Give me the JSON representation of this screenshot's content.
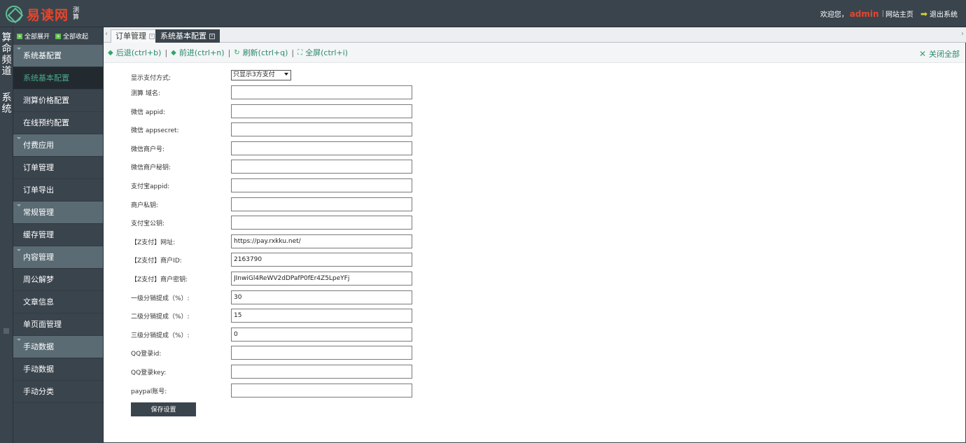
{
  "topbar": {
    "logo_text": "易读网",
    "logo_sub": "测算",
    "welcome": "欢迎您，",
    "user": "admin",
    "site_home": "网站主页",
    "logout": "退出系统",
    "separator": "|"
  },
  "channel": {
    "items": [
      "算命频道",
      "系统"
    ]
  },
  "sidebar": {
    "expand_all": "全部展开",
    "collapse_all": "全部收起",
    "menu": [
      {
        "type": "group",
        "label": "系统基配置"
      },
      {
        "type": "item",
        "label": "系统基本配置",
        "active": true
      },
      {
        "type": "item",
        "label": "测算价格配置"
      },
      {
        "type": "item",
        "label": "在线预约配置"
      },
      {
        "type": "group",
        "label": "付费应用"
      },
      {
        "type": "item",
        "label": "订单管理"
      },
      {
        "type": "item",
        "label": "订单导出"
      },
      {
        "type": "group",
        "label": "常规管理"
      },
      {
        "type": "item",
        "label": "缓存管理"
      },
      {
        "type": "group",
        "label": "内容管理"
      },
      {
        "type": "item",
        "label": "周公解梦"
      },
      {
        "type": "item",
        "label": "文章信息"
      },
      {
        "type": "item",
        "label": "单页面管理"
      },
      {
        "type": "group",
        "label": "手动数据"
      },
      {
        "type": "item",
        "label": "手动数据"
      },
      {
        "type": "item",
        "label": "手动分类"
      }
    ]
  },
  "tabs": {
    "items": [
      {
        "label": "订单管理",
        "active": false
      },
      {
        "label": "系统基本配置",
        "active": true
      }
    ]
  },
  "toolbar": {
    "back": "后退(ctrl+b)",
    "forward": "前进(ctrl+n)",
    "refresh": "刷新(ctrl+q)",
    "fullscreen": "全屏(ctrl+i)",
    "sep": "|",
    "close_all": "关闭全部"
  },
  "form": {
    "pay_mode_label": "显示支付方式:",
    "pay_mode_value": "只显示3方支付",
    "fields": [
      {
        "label": "测算 域名:",
        "value": "",
        "name": "domain-field"
      },
      {
        "label": "微信 appid:",
        "value": "",
        "name": "wechat-appid-field"
      },
      {
        "label": "微信 appsecret:",
        "value": "",
        "name": "wechat-appsecret-field"
      },
      {
        "label": "微信商户号:",
        "value": "",
        "name": "wechat-merchant-id-field"
      },
      {
        "label": "微信商户秘钥:",
        "value": "",
        "name": "wechat-merchant-key-field"
      },
      {
        "label": "支付宝appid:",
        "value": "",
        "name": "alipay-appid-field"
      },
      {
        "label": "商户私钥:",
        "value": "",
        "name": "merchant-private-key-field"
      },
      {
        "label": "支付宝公钥:",
        "value": "",
        "name": "alipay-public-key-field"
      },
      {
        "label": "【Z支付】网址:",
        "value": "https://pay.rxkku.net/",
        "name": "zpay-url-field"
      },
      {
        "label": "【Z支付】商户ID:",
        "value": "2163790",
        "name": "zpay-merchant-id-field"
      },
      {
        "label": "【Z支付】商户密钥:",
        "value": "JInwiGl4ReWV2dDPafP0fEr4Z5LpeYFj",
        "name": "zpay-merchant-key-field"
      },
      {
        "label": "一级分销提成（%）:",
        "value": "30",
        "name": "level1-commission-field"
      },
      {
        "label": "二级分销提成（%）:",
        "value": "15",
        "name": "level2-commission-field"
      },
      {
        "label": "三级分销提成（%）:",
        "value": "0",
        "name": "level3-commission-field"
      },
      {
        "label": "QQ登录id:",
        "value": "",
        "name": "qq-login-id-field"
      },
      {
        "label": "QQ登录key:",
        "value": "",
        "name": "qq-login-key-field"
      },
      {
        "label": "paypal账号:",
        "value": "",
        "name": "paypal-account-field"
      }
    ],
    "save_label": "保存设置"
  }
}
